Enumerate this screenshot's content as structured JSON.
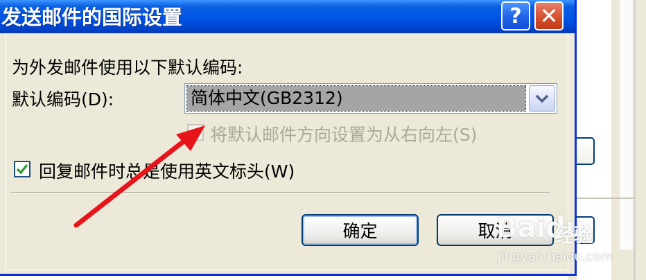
{
  "dialog": {
    "title": "发送邮件的国际设置",
    "help_glyph": "?",
    "close_glyph": "✕"
  },
  "content": {
    "default_encoding_heading": "为外发邮件使用以下默认编码:",
    "encoding_label": "默认编码(D):",
    "encoding_selected": "简体中文(GB2312)",
    "rtl_checkbox_label": "将默认邮件方向设置为从右向左(S)",
    "rtl_checked": false,
    "rtl_enabled": false,
    "english_header_label": "回复邮件时总是使用英文标头(W)",
    "english_header_checked": true
  },
  "buttons": {
    "ok_label": "确定",
    "cancel_label": "取消"
  },
  "watermark": {
    "brand": "Baidu",
    "brand_cn": "经验",
    "url": "jingyan.baidu.com"
  },
  "colors": {
    "titlebar_blue": "#0055e5",
    "dialog_face": "#ece9d8",
    "arrow_red": "#e8141c",
    "disabled_text": "#aca899",
    "selection_gray": "#a5a5a7"
  }
}
